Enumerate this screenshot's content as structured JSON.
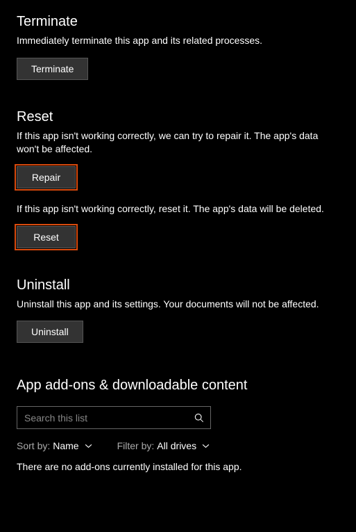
{
  "terminate": {
    "title": "Terminate",
    "desc": "Immediately terminate this app and its related processes.",
    "button": "Terminate"
  },
  "reset": {
    "title": "Reset",
    "repair_desc": "If this app isn't working correctly, we can try to repair it. The app's data won't be affected.",
    "repair_button": "Repair",
    "reset_desc": "If this app isn't working correctly, reset it. The app's data will be deleted.",
    "reset_button": "Reset"
  },
  "uninstall": {
    "title": "Uninstall",
    "desc": "Uninstall this app and its settings. Your documents will not be affected.",
    "button": "Uninstall"
  },
  "addons": {
    "title": "App add-ons & downloadable content",
    "search_placeholder": "Search this list",
    "sort_label": "Sort by:",
    "sort_value": "Name",
    "filter_label": "Filter by:",
    "filter_value": "All drives",
    "empty_message": "There are no add-ons currently installed for this app."
  }
}
